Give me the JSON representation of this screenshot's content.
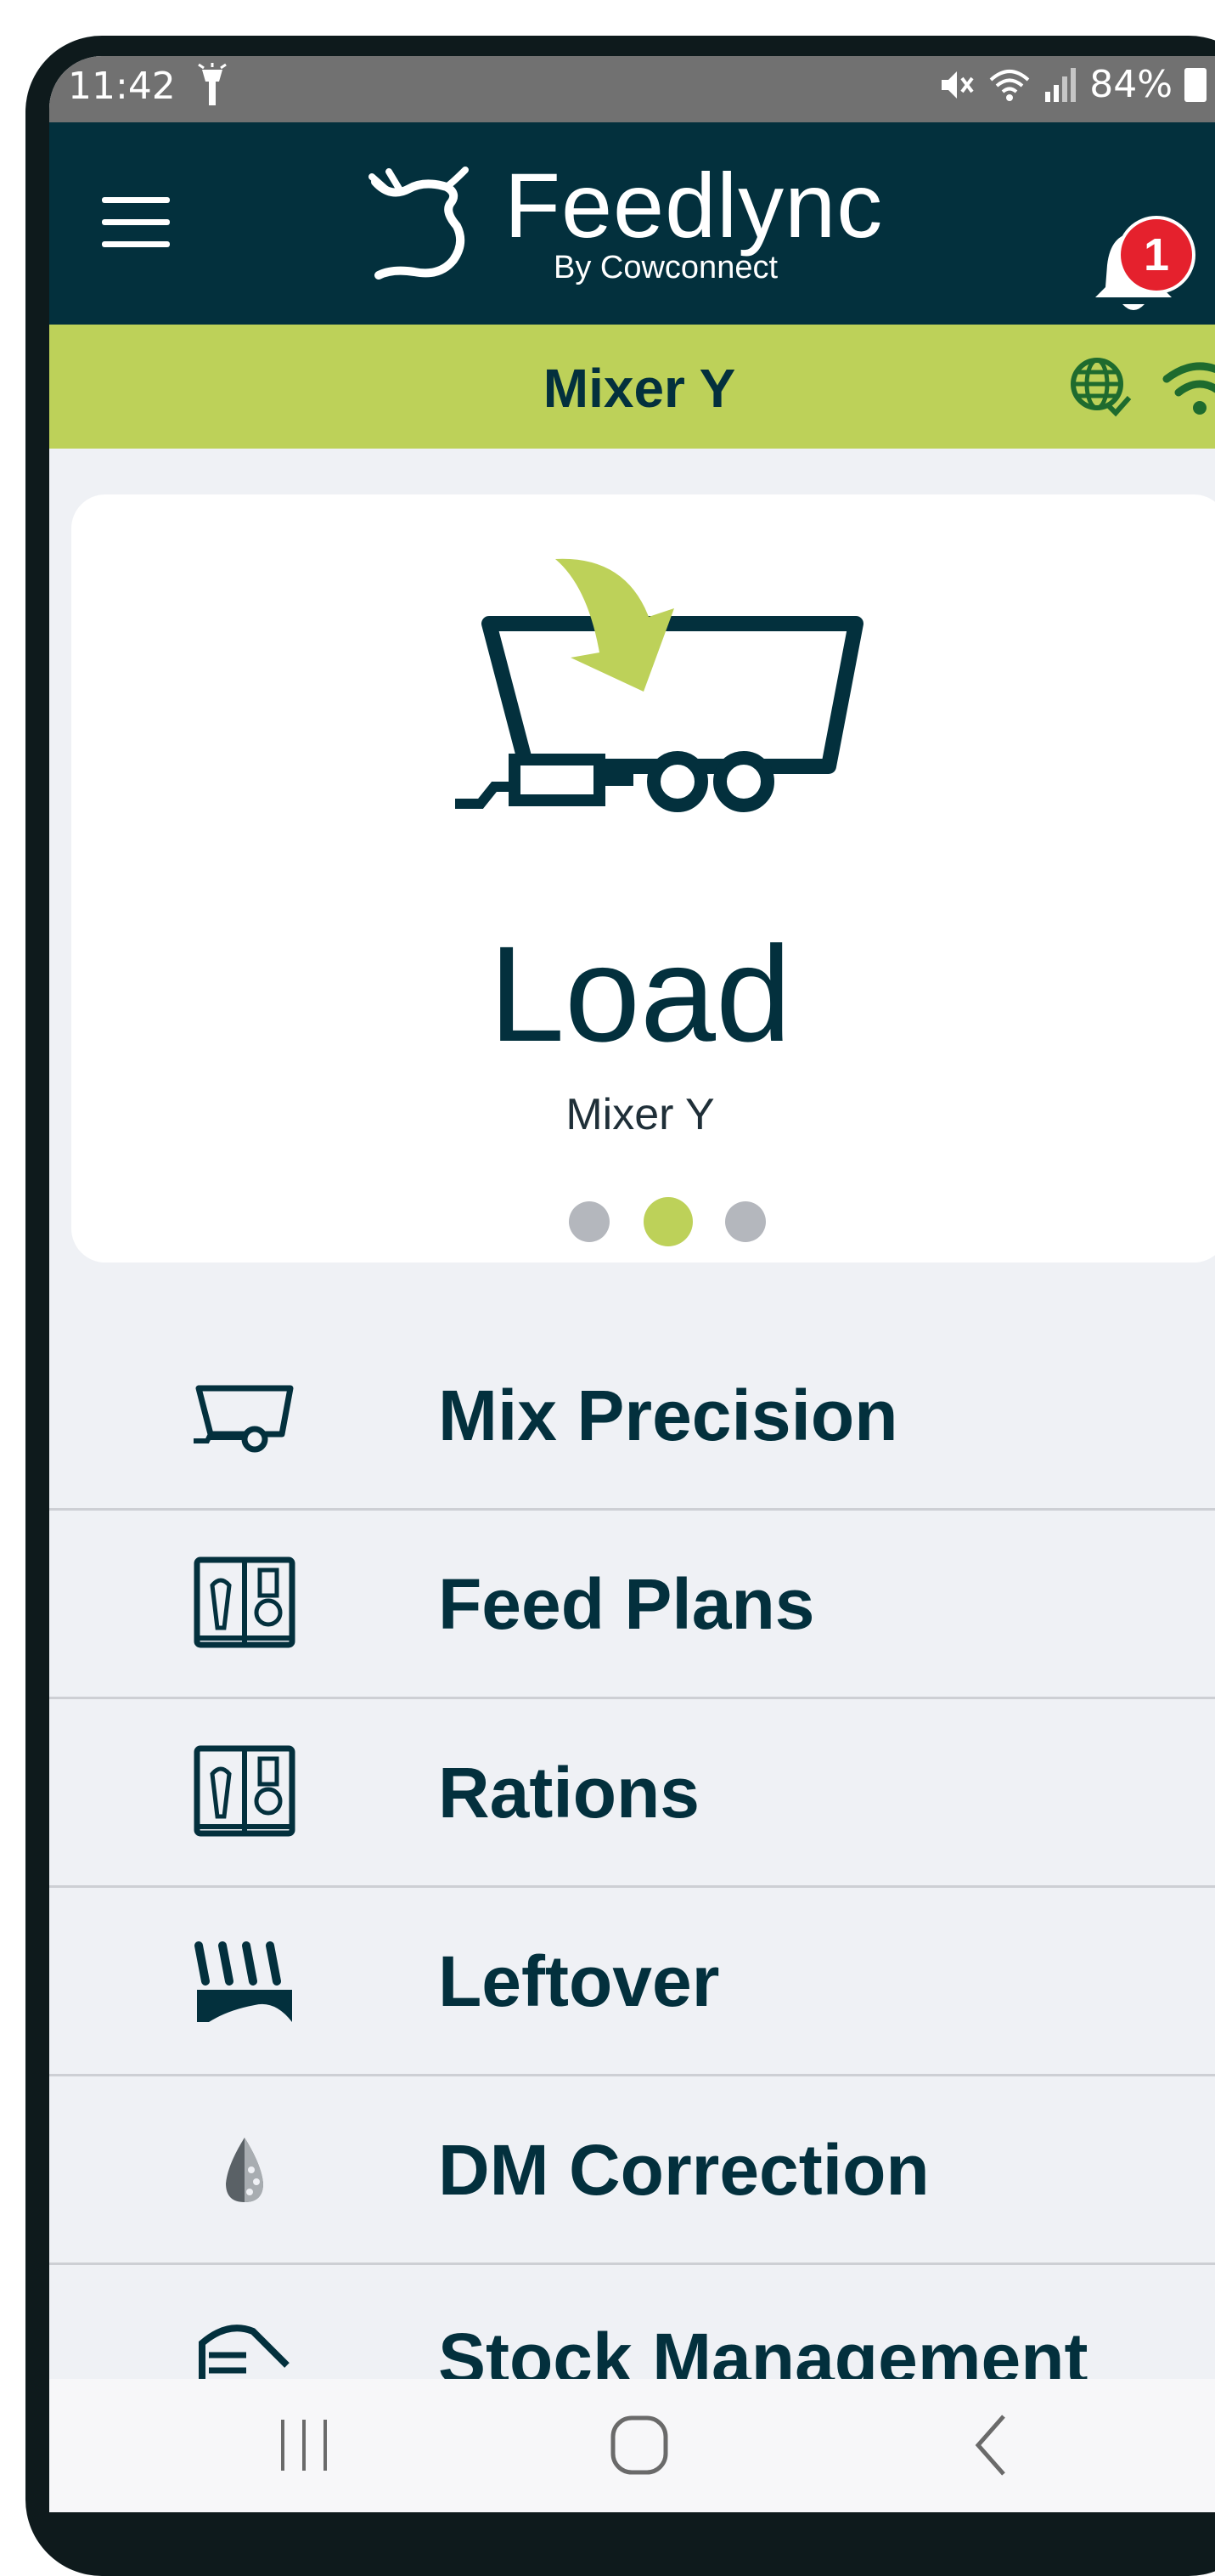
{
  "status_bar": {
    "time": "11:42",
    "battery": "84%",
    "icons": [
      "flashlight-icon",
      "mute-icon",
      "wifi-icon",
      "signal-icon",
      "battery-icon"
    ]
  },
  "header": {
    "brand": "Feedlync",
    "brand_sub": "By Cowconnect",
    "notification_count": "1",
    "icons": [
      "menu-icon",
      "cow-logo-icon",
      "bell-icon"
    ]
  },
  "mixer_bar": {
    "title": "Mixer Y",
    "icons": [
      "globe-check-icon",
      "wifi-icon"
    ]
  },
  "carousel": {
    "title": "Load",
    "subtitle": "Mixer Y",
    "active_index": 1,
    "page_count": 3,
    "icon": "mixer-wagon-load-icon"
  },
  "menu": {
    "items": [
      {
        "label": "Mix Precision",
        "icon": "mixer-wagon-icon"
      },
      {
        "label": "Feed Plans",
        "icon": "feed-book-icon"
      },
      {
        "label": "Rations",
        "icon": "ration-book-icon"
      },
      {
        "label": "Leftover",
        "icon": "leftover-icon"
      },
      {
        "label": "DM Correction",
        "icon": "dry-matter-drop-icon"
      },
      {
        "label": "Stock Management",
        "icon": "stock-bunker-icon"
      }
    ]
  },
  "colors": {
    "header_bg": "#03303d",
    "accent_green": "#bdd159",
    "badge_red": "#e5212d",
    "text_dark": "#03303d",
    "dot_inactive": "#b4b7bd",
    "page_bg": "#eff1f5"
  },
  "nav": {
    "icons": [
      "recent-apps-icon",
      "home-icon",
      "back-icon"
    ]
  }
}
